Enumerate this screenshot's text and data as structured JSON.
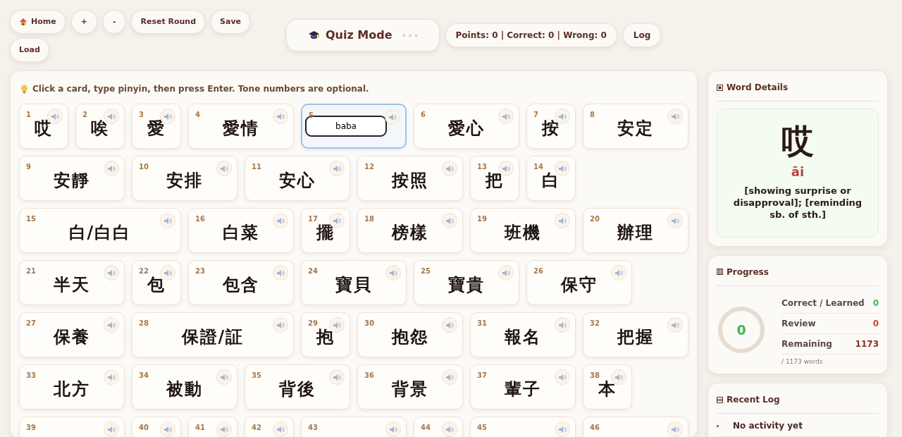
{
  "toolbar": {
    "buttons": [
      {
        "label": "Home",
        "kind": "home"
      },
      {
        "label": "+",
        "kind": "plain"
      },
      {
        "label": "-",
        "kind": "plain"
      },
      {
        "label": "Reset Round",
        "kind": "plain"
      },
      {
        "label": "Save",
        "kind": "plain"
      },
      {
        "label": "Load",
        "kind": "plain"
      }
    ],
    "mode": {
      "title": "Quiz Mode"
    },
    "score": "Points: 0 | Correct: 0 | Wrong: 0",
    "log_button": "Log"
  },
  "hint": "Click a card, type pinyin, then press Enter. Tone numbers are optional.",
  "cards": [
    {
      "number": "1",
      "word": "哎",
      "kind": "single",
      "selected": false
    },
    {
      "number": "2",
      "word": "唉",
      "kind": "single",
      "selected": false
    },
    {
      "number": "3",
      "word": "愛",
      "kind": "single",
      "selected": false
    },
    {
      "number": "4",
      "word": "愛情",
      "kind": "double",
      "selected": false
    },
    {
      "number": "5",
      "answer": "baba",
      "kind": "double",
      "selected": true
    },
    {
      "number": "6",
      "word": "愛心",
      "kind": "double",
      "selected": false
    },
    {
      "number": "7",
      "word": "按",
      "kind": "single",
      "selected": false
    },
    {
      "number": "8",
      "word": "安定",
      "kind": "double",
      "selected": false
    },
    {
      "number": "9",
      "word": "安靜",
      "kind": "double",
      "selected": false
    },
    {
      "number": "10",
      "word": "安排",
      "kind": "double",
      "selected": false
    },
    {
      "number": "11",
      "word": "安心",
      "kind": "double",
      "selected": false
    },
    {
      "number": "12",
      "word": "按照",
      "kind": "double",
      "selected": false
    },
    {
      "number": "13",
      "word": "把",
      "kind": "single",
      "selected": false
    },
    {
      "number": "14",
      "word": "白",
      "kind": "single",
      "selected": false
    },
    {
      "number": "15",
      "word": "白/白白",
      "kind": "triple",
      "selected": false
    },
    {
      "number": "16",
      "word": "白菜",
      "kind": "double",
      "selected": false
    },
    {
      "number": "17",
      "word": "擺",
      "kind": "single",
      "selected": false
    },
    {
      "number": "18",
      "word": "榜樣",
      "kind": "double",
      "selected": false
    },
    {
      "number": "19",
      "word": "班機",
      "kind": "double",
      "selected": false
    },
    {
      "number": "20",
      "word": "辦理",
      "kind": "double",
      "selected": false
    },
    {
      "number": "21",
      "word": "半天",
      "kind": "double",
      "selected": false
    },
    {
      "number": "22",
      "word": "包",
      "kind": "single",
      "selected": false
    },
    {
      "number": "23",
      "word": "包含",
      "kind": "double",
      "selected": false
    },
    {
      "number": "24",
      "word": "寶貝",
      "kind": "double",
      "selected": false
    },
    {
      "number": "25",
      "word": "寶貴",
      "kind": "double",
      "selected": false
    },
    {
      "number": "26",
      "word": "保守",
      "kind": "double",
      "selected": false
    },
    {
      "number": "27",
      "word": "保養",
      "kind": "double",
      "selected": false
    },
    {
      "number": "28",
      "word": "保證/証",
      "kind": "triple",
      "selected": false
    },
    {
      "number": "29",
      "word": "抱",
      "kind": "single",
      "selected": false
    },
    {
      "number": "30",
      "word": "抱怨",
      "kind": "double",
      "selected": false
    },
    {
      "number": "31",
      "word": "報名",
      "kind": "double",
      "selected": false
    },
    {
      "number": "32",
      "word": "把握",
      "kind": "double",
      "selected": false
    },
    {
      "number": "33",
      "word": "北方",
      "kind": "double",
      "selected": false
    },
    {
      "number": "34",
      "word": "被動",
      "kind": "double",
      "selected": false
    },
    {
      "number": "35",
      "word": "背後",
      "kind": "double",
      "selected": false
    },
    {
      "number": "36",
      "word": "背景",
      "kind": "double",
      "selected": false
    },
    {
      "number": "37",
      "word": "輩子",
      "kind": "double",
      "selected": false
    },
    {
      "number": "38",
      "word": "本",
      "kind": "single",
      "selected": false
    },
    {
      "number": "39",
      "kind": "double",
      "selected": false
    },
    {
      "number": "40",
      "kind": "single",
      "selected": false
    },
    {
      "number": "41",
      "kind": "single",
      "selected": false
    },
    {
      "number": "42",
      "kind": "single",
      "selected": false
    },
    {
      "number": "43",
      "kind": "double",
      "selected": false
    },
    {
      "number": "44",
      "kind": "single",
      "selected": false
    },
    {
      "number": "45",
      "kind": "double",
      "selected": false
    },
    {
      "number": "46",
      "kind": "double",
      "selected": false
    }
  ],
  "word_details": {
    "title": "Word Details",
    "word": "哎",
    "pinyin": "āi",
    "definition": "[showing surprise or disapproval]; [reminding sb. of sth.]"
  },
  "progress": {
    "title": "Progress",
    "ring": {
      "value": "0"
    },
    "stats": [
      {
        "label": "Correct / Learned",
        "value": "0",
        "color": "#3cba54"
      },
      {
        "label": "Review",
        "value": "0",
        "color": "#d0413a"
      },
      {
        "label": "Remaining",
        "value": "1173",
        "color": "#8e2a1e"
      }
    ],
    "total": "/ 1173 words"
  },
  "recent_log": {
    "title": "Recent Log",
    "items": [
      "No activity yet"
    ]
  }
}
